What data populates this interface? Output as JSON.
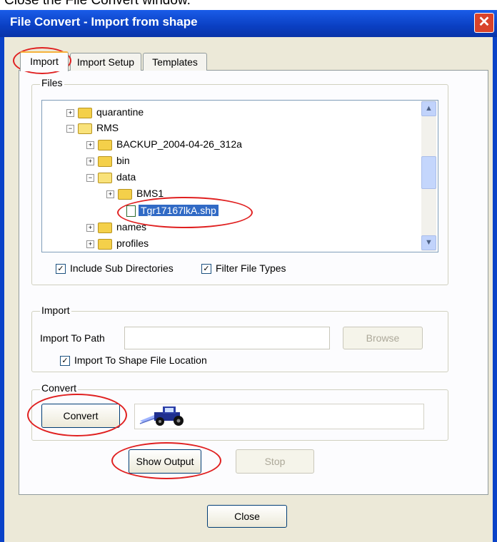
{
  "caption": "Close the File Convert window.",
  "window": {
    "title": "File Convert - Import from shape",
    "close_glyph": "✕"
  },
  "tabs": [
    {
      "label": "Import",
      "active": true
    },
    {
      "label": "Import Setup"
    },
    {
      "label": "Templates"
    }
  ],
  "files": {
    "group_label": "Files",
    "tree": [
      {
        "label": "quarantine",
        "expander": "+",
        "icon": "folder-icon"
      },
      {
        "label": "RMS",
        "expander": "−",
        "icon": "open-folder-icon"
      },
      {
        "label": "BACKUP_2004-04-26_312a",
        "expander": "+",
        "icon": "folder-icon"
      },
      {
        "label": "bin",
        "expander": "+",
        "icon": "folder-icon"
      },
      {
        "label": "data",
        "expander": "−",
        "icon": "open-folder-icon"
      },
      {
        "label": "BMS1",
        "expander": "+",
        "icon": "folder-icon"
      },
      {
        "label": "Tgr17167lkA.shp",
        "selected": true,
        "icon": "shapefile-icon"
      },
      {
        "label": "names",
        "expander": "+",
        "icon": "folder-icon"
      },
      {
        "label": "profiles",
        "expander": "+",
        "icon": "folder-icon"
      }
    ],
    "include_subdirs_label": "Include Sub Directories",
    "include_subdirs_checked": true,
    "filter_types_label": "Filter File Types",
    "filter_types_checked": true
  },
  "import": {
    "group_label": "Import",
    "path_label": "Import To Path",
    "path_value": "",
    "browse_label": "Browse",
    "use_shape_location_label": "Import To Shape File Location",
    "use_shape_location_checked": true
  },
  "convert": {
    "group_label": "Convert",
    "convert_label": "Convert",
    "show_output_label": "Show Output",
    "stop_label": "Stop"
  },
  "close_label": "Close",
  "colors": {
    "title_bar": "#0a42c8",
    "selection": "#316ac5",
    "highlight_ring": "#e02020",
    "tractor_body": "#1f2f8f"
  }
}
